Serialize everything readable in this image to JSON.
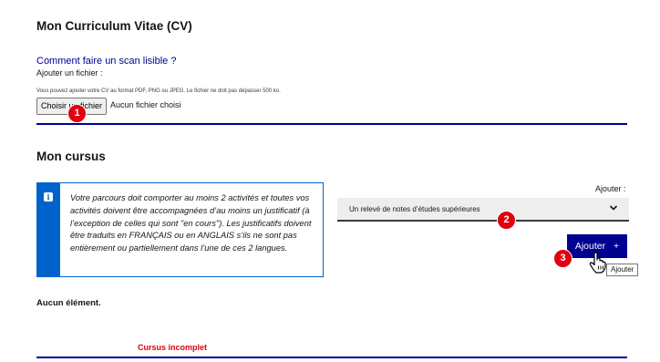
{
  "cv_section": {
    "title": "Mon Curriculum Vitae (CV)",
    "help_link": "Comment faire un scan lisible ?",
    "add_file_label": "Ajouter un fichier :",
    "hint": "Vous pouvez ajouter votre CV au format PDF, PNG ou JPEG. Le fichier ne doit pas dépasser 500 ko.",
    "choose_button": "Choisir un fichier",
    "no_file": "Aucun fichier choisi"
  },
  "cursus_section": {
    "title": "Mon cursus",
    "notice": "Votre parcours doit comporter au moins 2 activités et toutes vos activités doivent être accompagnées d’au moins un justificatif (à l’exception de celles qui sont \"en cours\"). Les justificatifs doivent être traduits en FRANÇAIS ou en ANGLAIS s’ils ne sont pas entièrement ou partiellement dans l’une de ces 2 langues.",
    "add_label": "Ajouter :",
    "select_value": "Un relevé de notes d’études supérieures",
    "add_button": "Ajouter",
    "add_button_icon": "+",
    "tooltip": "Ajouter",
    "empty": "Aucun élément.",
    "status": "Cursus incomplet"
  },
  "annotations": {
    "badge1": "1",
    "badge2": "2",
    "badge3": "3"
  },
  "colors": {
    "primary": "#000091",
    "info": "#0063cb",
    "error": "#e1000f",
    "marker": "#e1000f"
  }
}
